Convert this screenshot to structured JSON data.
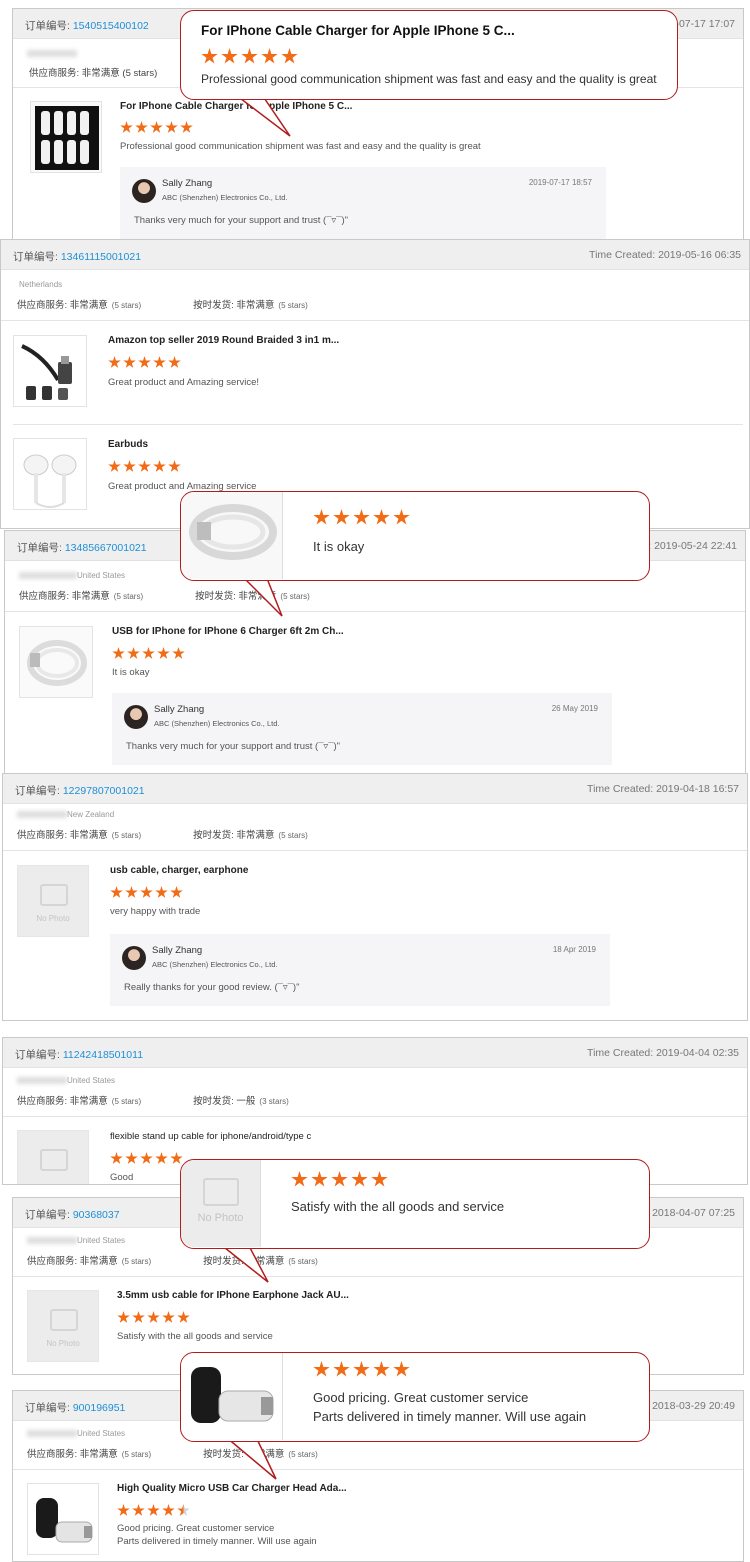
{
  "colors": {
    "star": "#f26b16",
    "order_link": "#1e8fd6",
    "bubble_border": "#b21c1c"
  },
  "cards": [
    {
      "order_label": "订单编号:",
      "order_number": "1540515400102",
      "time": "2019-07-17 17:07",
      "supplier_rating": "供应商服务: 非常满意 (5 stars)",
      "product": {
        "title": "For IPhone Cable Charger for Apple IPhone 5 C...",
        "rating": 5,
        "review": "Professional good communication shipment was fast and easy and the quality is great"
      },
      "reply": {
        "name": "Sally Zhang",
        "company": "ABC (Shenzhen) Electronics Co., Ltd.",
        "date": "2019-07-17 18:57",
        "message": "Thanks very much for your support and trust (¯▿¯)\""
      }
    },
    {
      "order_label": "订单编号:",
      "order_number": "13461115001021",
      "time": "Time Created: 2019-05-16 06:35",
      "buyer_country": "Netherlands",
      "supplier_service": "供应商服务: 非常满意",
      "supplier_stars": "(5 stars)",
      "shipping_service": "按时发货: 非常满意",
      "shipping_stars": "(5 stars)",
      "products": [
        {
          "title": "Amazon top seller 2019 Round Braided 3 in1 m...",
          "rating": 5,
          "review": "Great product and Amazing service!"
        },
        {
          "title": "Earbuds",
          "rating": 5,
          "review": "Great product and Amazing service"
        }
      ]
    },
    {
      "order_label": "订单编号:",
      "order_number": "13485667001021",
      "time": "Time Created: 2019-05-24 22:41",
      "buyer_country": "United States",
      "supplier_service": "供应商服务: 非常满意",
      "supplier_stars": "(5 stars)",
      "shipping_service": "按时发货: 非常满意",
      "shipping_stars": "(5 stars)",
      "product": {
        "title": "USB for IPhone for IPhone 6 Charger 6ft 2m Ch...",
        "rating": 5,
        "review": "It is okay"
      },
      "reply": {
        "name": "Sally Zhang",
        "company": "ABC (Shenzhen) Electronics Co., Ltd.",
        "date": "26 May 2019",
        "message": "Thanks very much for your support and trust (¯▿¯)\""
      }
    },
    {
      "order_label": "订单编号:",
      "order_number": "12297807001021",
      "time": "Time Created: 2019-04-18 16:57",
      "buyer_country": "New Zealand",
      "supplier_service": "供应商服务: 非常满意",
      "supplier_stars": "(5 stars)",
      "shipping_service": "按时发货: 非常满意",
      "shipping_stars": "(5 stars)",
      "product": {
        "title": "usb cable, charger, earphone",
        "rating": 5,
        "review": "very happy with trade",
        "no_photo": "No Photo"
      },
      "reply": {
        "name": "Sally Zhang",
        "company": "ABC (Shenzhen) Electronics Co., Ltd.",
        "date": "18 Apr 2019",
        "message": "Really thanks for your good review. (¯▿¯)\""
      }
    },
    {
      "order_label": "订单编号:",
      "order_number": "11242418501011",
      "time": "Time Created: 2019-04-04 02:35",
      "buyer_country": "United States",
      "supplier_service": "供应商服务: 非常满意",
      "supplier_stars": "(5 stars)",
      "shipping_service": "按时发货: 一般",
      "shipping_stars": "(3 stars)",
      "product": {
        "title": "flexible stand up cable for iphone/android/type c",
        "rating": 5,
        "review": "Good"
      }
    },
    {
      "order_label": "订单编号:",
      "order_number": "90368037",
      "time": "2018-04-07 07:25",
      "buyer_country": "United States",
      "supplier_service": "供应商服务: 非常满意",
      "supplier_stars": "(5 stars)",
      "shipping_service": "按时发货: 非常满意",
      "shipping_stars": "(5 stars)",
      "product": {
        "title": "3.5mm usb cable for IPhone Earphone Jack AU...",
        "rating": 5,
        "review": "Satisfy with the all goods and service",
        "no_photo": "No Photo"
      }
    },
    {
      "order_label": "订单编号:",
      "order_number": "900196951",
      "time": "2018-03-29 20:49",
      "buyer_country": "United States",
      "supplier_service": "供应商服务: 非常满意",
      "supplier_stars": "(5 stars)",
      "shipping_service": "按时发货: 非常满意",
      "shipping_stars": "(5 stars)",
      "product": {
        "title": "High Quality Micro USB Car Charger Head Ada...",
        "rating": 4.5,
        "review_line1": "Good pricing. Great customer service",
        "review_line2": "Parts delivered in timely manner. Will use again"
      }
    }
  ],
  "callouts": [
    {
      "title": "For IPhone Cable Charger for Apple IPhone 5 C...",
      "rating": 5,
      "text": "Professional good communication shipment was fast and easy and the quality is great"
    },
    {
      "rating": 5,
      "text": "It is okay"
    },
    {
      "rating": 5,
      "text": "Satisfy with the all goods and service",
      "no_photo": "No Photo"
    },
    {
      "rating": 5,
      "text_line1": "Good pricing. Great customer service",
      "text_line2": "Parts delivered in timely manner. Will use again"
    }
  ]
}
